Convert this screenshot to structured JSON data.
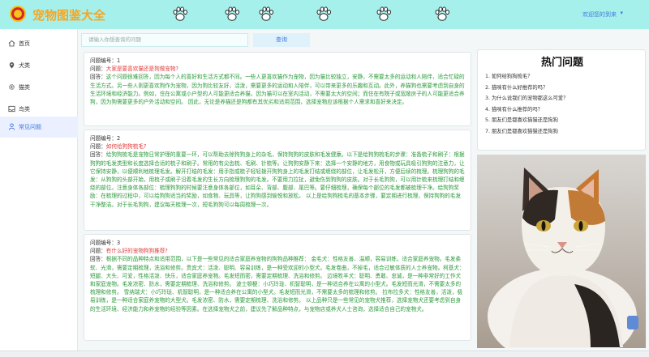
{
  "header": {
    "title": "宠物图鉴大全",
    "welcome": "欢迎您的到来",
    "welcome_caret": "▾",
    "colors": {
      "bar": "#a6f0ec",
      "title": "#f5a623",
      "accent": "#3e79d8"
    },
    "decor_icons": [
      "paw-icon",
      "paw-icon",
      "paw-icon",
      "paw-icon",
      "paw-icon",
      "paw-icon"
    ]
  },
  "sidebar": {
    "items": [
      {
        "label": "首页",
        "icon": "home-icon",
        "active": false
      },
      {
        "label": "犬类",
        "icon": "location-icon",
        "active": false
      },
      {
        "label": "猫类",
        "icon": "gear-icon",
        "active": false
      },
      {
        "label": "鸟类",
        "icon": "inbox-icon",
        "active": false
      },
      {
        "label": "常见问题",
        "icon": "user-icon",
        "active": true
      }
    ]
  },
  "search": {
    "placeholder": "请输入你想查询的问题",
    "button_label": "查询"
  },
  "questions": [
    {
      "number_label": "问题编号：1",
      "question_prefix": "问题：",
      "question": "大家是要喜欢猫还是狗做宠物?",
      "answer_prefix": "回答：",
      "answer": "这个问题很难回答，因为每个人的喜好和生活方式都不同。一些人更喜欢猫作为宠物，因为猫比较独立，安静，不需要太多的运动和人陪伴，适合忙碌的生活方式。另一些人则更喜欢狗作为宠物，因为狗比较友好，活泼，需要更多的运动和人陪伴，可以带来更多的乐趣和互动。此外，养猫狗也需要考虑到自身的生活环境和经济能力。例如，住在公寓或小户型的人可能更适合养猫，因为猫可以在室内活动，不需要太大的空间；而住在有院子或宽敞房子的人可能更适合养狗，因为狗需要更多的户外活动和空间。 因此，无论是养猫还是狗都有其优劣和适用范围，选择宠物应该根据个人需求和喜好来决定。"
    },
    {
      "number_label": "问题编号：2",
      "question_prefix": "问题：",
      "question": "如何给狗狗梳毛?",
      "answer_prefix": "回答：",
      "answer": "给狗狗梳毛是宠物日常护理的重要一环，可以帮助去除狗狗身上的杂毛，保持狗狗的皮肤和毛发健康。以下是给狗狗梳毛的步骤：准备梳子和刷子：根据狗狗的毛发类型和长度选择合适的梳子和刷子。常用的有尖齿梳、毛刷、针梳等。让狗狗安静下来：选择一个安静的地方，用食物或玩具吸引狗狗的注意力，让它保持安静，以便顺利地梳理毛发。解开打结的毛发：用手指或梳子轻轻拨开狗狗身上的毛发打结或缠绕的部位，让毛发松开，方便后续的梳理。梳理狗狗的毛发：从狗狗的头部开始，用梳子或刷子沿着毛发的生长方向梳理狗狗的毛发。不要用力拉扯，避免伤到狗狗的皮肤。对于长毛狗狗，可以用针梳来梳理打结和缠绕的部位。注意身体各部位：梳理狗狗的时候要注意身体各部位，如耳朵、背部、腹部、尾巴等。要仔细梳理，确保每个部位的毛发都被梳理干净。给狗狗奖励：在梳理的过程中，可以给狗狗适当的奖励，如食物、玩具等，让狗狗感到愉悦和放松。 以上是给狗狗梳毛的基本步骤，要定期进行梳理，保持狗狗的毛发干净整洁。对于长毛狗狗，建议每天梳理一次，短毛狗狗可以每周梳理一次。"
    },
    {
      "number_label": "问题编号：3",
      "question_prefix": "问题：",
      "question": "有什么好的宠物狗狗推荐?",
      "answer_prefix": "回答：",
      "answer": "根据不同的品种特点和适用范围，以下是一些常见的适合家庭养宠物的狗狗品种推荐： 金毛犬：性格友善、温顺，容易训练，适合家庭养宠物。毛发柔软、光滑，需要定期梳理，洗浴和修剪。贵宾犬：活泼、聪明、容易训练，是一种受欢迎的小型犬。毛发卷曲，不掉毛，适合过敏体质的人士养宠物。柯基犬：短腿、大头、可爱，性格活泼、快乐，适合家庭养宠物。毛发短而密，需要定期梳理、洗浴和修剪。 边境牧羊犬：聪明、勇敢、忠诚，是一种非常好的工作犬和家庭宠物。毛发浓密、防水，需要定期梳理、洗浴和修剪。 波士顿梗：小巧玲珑、机智聪明，是一种适合养在公寓的小型犬。毛发短而光滑，不需要太多的梳理和修剪。 雪纳瑞犬：小巧玲珑、机智聪明，是一种适合养在公寓的小型犬。毛发短而光滑，不需要太多的梳理和修剪。 拉布拉多犬：性格友善，活泼，极易训练，是一种适合家庭养宠物的大型犬。毛发浓密、防水，需要定期梳理、洗浴和修剪。 以上品种只是一些常见的宠物犬推荐，选择宠物犬还要考虑到自身的生活环境、经济能力和养宠物的经验等因素。在选择宠物犬之前，建议先了解品种特点，与宠物店或养犬人士咨询，选择适合自己的宠物犬。"
    }
  ],
  "hot_questions": {
    "title": "热门问题",
    "items": [
      "1. 如何给狗狗梳毛？",
      "2. 猫咪有什么好推荐的吗？",
      "3. 为什么说我们的宠物都这么可爱？",
      "4. 猫咪有什么推荐的吗？",
      "5. 朋友们是都喜欢猫猫还是狗狗",
      "7. 朋友们是都喜欢猫猫还是狗狗"
    ]
  }
}
